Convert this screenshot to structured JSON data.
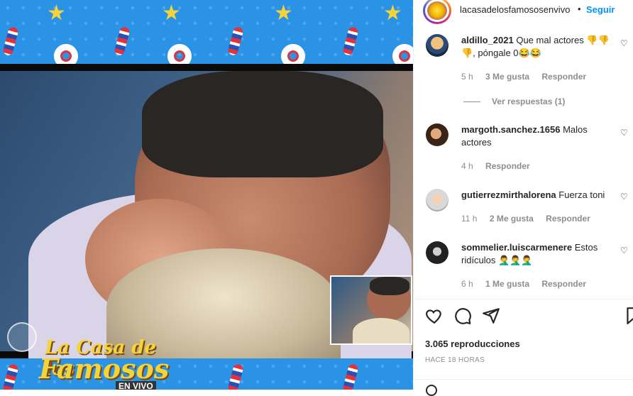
{
  "post": {
    "account": "lacasadelosfamososenvivo",
    "separator": "•",
    "follow_label": "Seguir"
  },
  "media": {
    "logo_line1": "La Casa de los",
    "logo_line2": "Famosos",
    "logo_line3": "EN VIVO"
  },
  "comments": [
    {
      "user": "aldillo_2021",
      "text": "Que mal actores 👎👎👎, póngale 0😂😂",
      "time": "5 h",
      "likes": "3 Me gusta",
      "reply": "Responder"
    },
    {
      "user": "margoth.sanchez.1656",
      "text": "Malos actores",
      "time": "4 h",
      "likes": "",
      "reply": "Responder"
    },
    {
      "user": "gutierrezmirthalorena",
      "text": "Fuerza toni",
      "time": "11 h",
      "likes": "2 Me gusta",
      "reply": "Responder"
    },
    {
      "user": "sommelier.luiscarmenere",
      "text": "Estos ridículos 🤦‍♂️🤦‍♂️🤦‍♂️",
      "time": "6 h",
      "likes": "1 Me gusta",
      "reply": "Responder"
    }
  ],
  "view_replies": "Ver respuestas (1)",
  "stats": {
    "views": "3.065 reproducciones",
    "posted": "HACE 18 HORAS"
  },
  "icons": [
    "heart-icon",
    "comment-icon",
    "share-icon",
    "bookmark-icon",
    "emoji-icon"
  ],
  "colors": {
    "follow": "#0095f6",
    "muted": "#8e8e8e",
    "text": "#262626"
  }
}
